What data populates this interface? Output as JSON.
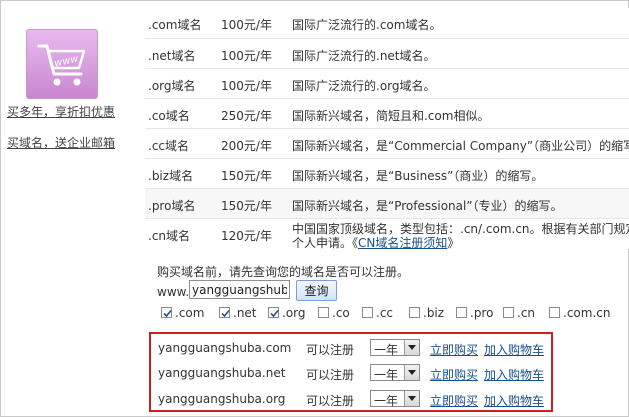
{
  "sidebar": {
    "links": [
      "买多年，享折扣优惠",
      "买域名，送企业邮箱"
    ],
    "cart_icon_text": "www"
  },
  "pricing": [
    {
      "tld": ".com域名",
      "price": "100元/年",
      "desc": "国际广泛流行的.com域名。"
    },
    {
      "tld": ".net域名",
      "price": "100元/年",
      "desc": "国际广泛流行的.net域名。"
    },
    {
      "tld": ".org域名",
      "price": "100元/年",
      "desc": "国际广泛流行的.org域名。"
    },
    {
      "tld": ".co域名",
      "price": "250元/年",
      "desc": "国际新兴域名，简短且和.com相似。"
    },
    {
      "tld": ".cc域名",
      "price": "200元/年",
      "desc": "国际新兴域名，是“Commercial Company”（商业公司）的缩写"
    },
    {
      "tld": ".biz域名",
      "price": "150元/年",
      "desc": "国际新兴域名，是“Business”（商业）的缩写。"
    },
    {
      "tld": ".pro域名",
      "price": "150元/年",
      "desc": "国际新兴域名，是“Professional”（专业）的缩写。"
    },
    {
      "tld": ".cn域名",
      "price": "120元/年",
      "desc_line1": "中国国家顶级域名，类型包括：.cn/.com.cn。根据有关部门规定",
      "desc_line2_pre": "个人申请。《",
      "desc_link": "CN域名注册须知",
      "desc_line2_post": "》"
    }
  ],
  "search": {
    "prompt": "购买域名前，请先查询您的域名是否可以注册。",
    "www_label": "www.",
    "value": "yangguangshuba",
    "button": "查询"
  },
  "tld_options": [
    {
      "label": ".com",
      "checked": true
    },
    {
      "label": ".net",
      "checked": true
    },
    {
      "label": ".org",
      "checked": true
    },
    {
      "label": ".co",
      "checked": false
    },
    {
      "label": ".cc",
      "checked": false
    },
    {
      "label": ".biz",
      "checked": false
    },
    {
      "label": ".pro",
      "checked": false
    },
    {
      "label": ".cn",
      "checked": false
    },
    {
      "label": ".com.cn",
      "checked": false
    }
  ],
  "results": [
    {
      "domain": "yangguangshuba.com",
      "status": "可以注册",
      "period": "一年",
      "buy": "立即购买",
      "add_cart": "加入购物车"
    },
    {
      "domain": "yangguangshuba.net",
      "status": "可以注册",
      "period": "一年",
      "buy": "立即购买",
      "add_cart": "加入购物车"
    },
    {
      "domain": "yangguangshuba.org",
      "status": "可以注册",
      "period": "一年",
      "buy": "立即购买",
      "add_cart": "加入购物车"
    }
  ],
  "colors": {
    "highlight_border": "#cc1f1f",
    "link": "#1a4f8f",
    "cart_icon_bg": "#d9a0de"
  }
}
